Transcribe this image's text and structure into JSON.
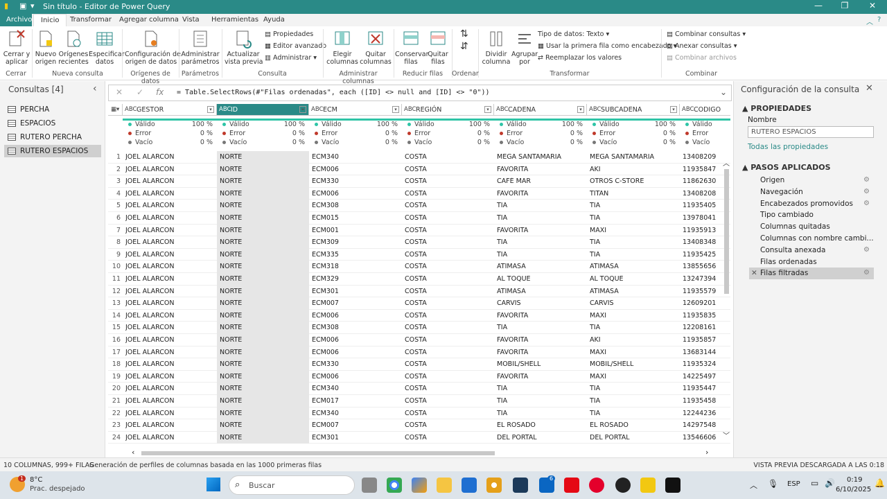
{
  "window": {
    "title": "Sin título - Editor de Power Query"
  },
  "menu": [
    "Archivo",
    "Inicio",
    "Transformar",
    "Agregar columna",
    "Vista",
    "Herramientas",
    "Ayuda"
  ],
  "ribbon": {
    "cerrar_aplicar": "Cerrar y\naplicar",
    "nuevo_origen": "Nuevo\norigen",
    "origenes_recientes": "Orígenes\nrecientes",
    "especificar_datos": "Especificar\ndatos",
    "config_origen": "Configuración de\norigen de datos",
    "admin_param": "Administrar\nparámetros",
    "actualizar": "Actualizar\nvista previa",
    "propiedades": "Propiedades",
    "editor_avanzado": "Editor avanzado",
    "administrar": "Administrar",
    "elegir_columnas": "Elegir\ncolumnas",
    "quitar_columnas": "Quitar\ncolumnas",
    "conservar_filas": "Conservar\nfilas",
    "quitar_filas": "Quitar\nfilas",
    "dividir_columna": "Dividir\ncolumna",
    "agrupar_por": "Agrupar\npor",
    "tipo_datos": "Tipo de datos: Texto",
    "primera_fila": "Usar la primera fila como encabezado",
    "reemplazar": "Reemplazar los valores",
    "combinar_consultas": "Combinar consultas",
    "anexar_consultas": "Anexar consultas",
    "combinar_archivos": "Combinar archivos",
    "groups": {
      "cerrar": "Cerrar",
      "nueva_consulta": "Nueva consulta",
      "origenes": "Orígenes de datos",
      "parametros": "Parámetros",
      "consulta": "Consulta",
      "admin_col": "Administrar columnas",
      "reducir": "Reducir filas",
      "ordenar": "Ordenar",
      "transformar": "Transformar",
      "combinar": "Combinar"
    }
  },
  "queries": {
    "title": "Consultas [4]",
    "items": [
      "PERCHA",
      "ESPACIOS",
      "RUTERO PERCHA",
      "RUTERO ESPACIOS"
    ],
    "selected": 3
  },
  "formula": "= Table.SelectRows(#\"Filas ordenadas\", each ([ID] <> null and [ID] <> \"0\"))",
  "columns": [
    {
      "name": "GESTOR",
      "type": "ABC"
    },
    {
      "name": "ID",
      "type": "ABC"
    },
    {
      "name": "ECM",
      "type": "ABC"
    },
    {
      "name": "REGIÓN",
      "type": "ABC"
    },
    {
      "name": "CADENA",
      "type": "ABC"
    },
    {
      "name": "SUBCADENA",
      "type": "ABC"
    },
    {
      "name": "CODIGO",
      "type": "ABC"
    }
  ],
  "quality": {
    "valid_label": "Válido",
    "error_label": "Error",
    "empty_label": "Vacío",
    "valid": "100 %",
    "error": "0 %",
    "empty": "0 %"
  },
  "rows": [
    [
      "JOEL ALARCON",
      "NORTE",
      "ECM340",
      "COSTA",
      "MEGA SANTAMARIA",
      "MEGA SANTAMARIA",
      "13408209"
    ],
    [
      "JOEL ALARCON",
      "NORTE",
      "ECM006",
      "COSTA",
      "FAVORITA",
      "AKI",
      "11935847"
    ],
    [
      "JOEL ALARCON",
      "NORTE",
      "ECM330",
      "COSTA",
      "CAFÉ MAR",
      "OTROS C-STORE",
      "11862630"
    ],
    [
      "JOEL ALARCON",
      "NORTE",
      "ECM006",
      "COSTA",
      "FAVORITA",
      "TITAN",
      "13408208"
    ],
    [
      "JOEL ALARCON",
      "NORTE",
      "ECM308",
      "COSTA",
      "TIA",
      "TIA",
      "11935405"
    ],
    [
      "JOEL ALARCON",
      "NORTE",
      "ECM015",
      "COSTA",
      "TIA",
      "TIA",
      "13978041"
    ],
    [
      "JOEL ALARCON",
      "NORTE",
      "ECM001",
      "COSTA",
      "FAVORITA",
      "MAXI",
      "11935913"
    ],
    [
      "JOEL ALARCON",
      "NORTE",
      "ECM309",
      "COSTA",
      "TIA",
      "TIA",
      "13408348"
    ],
    [
      "JOEL ALARCON",
      "NORTE",
      "ECM335",
      "COSTA",
      "TIA",
      "TIA",
      "11935425"
    ],
    [
      "JOEL ALARCON",
      "NORTE",
      "ECM318",
      "COSTA",
      "ATIMASA",
      "ATIMASA",
      "13855656"
    ],
    [
      "JOEL ALARCON",
      "NORTE",
      "ECM329",
      "COSTA",
      "AL TOQUE",
      "AL TOQUE",
      "13247394"
    ],
    [
      "JOEL ALARCON",
      "NORTE",
      "ECM301",
      "COSTA",
      "ATIMASA",
      "ATIMASA",
      "11935579"
    ],
    [
      "JOEL ALARCON",
      "NORTE",
      "ECM007",
      "COSTA",
      "CARVIS",
      "CARVIS",
      "12609201"
    ],
    [
      "JOEL ALARCON",
      "NORTE",
      "ECM006",
      "COSTA",
      "FAVORITA",
      "MAXI",
      "11935835"
    ],
    [
      "JOEL ALARCON",
      "NORTE",
      "ECM308",
      "COSTA",
      "TIA",
      "TIA",
      "12208161"
    ],
    [
      "JOEL ALARCON",
      "NORTE",
      "ECM006",
      "COSTA",
      "FAVORITA",
      "AKI",
      "11935857"
    ],
    [
      "JOEL ALARCON",
      "NORTE",
      "ECM006",
      "COSTA",
      "FAVORITA",
      "MAXI",
      "13683144"
    ],
    [
      "JOEL ALARCON",
      "NORTE",
      "ECM330",
      "COSTA",
      "MOBIL/SHELL",
      "MOBIL/SHELL",
      "11935324"
    ],
    [
      "JOEL ALARCON",
      "NORTE",
      "ECM006",
      "COSTA",
      "FAVORITA",
      "MAXI",
      "14225497"
    ],
    [
      "JOEL ALARCON",
      "NORTE",
      "ECM340",
      "COSTA",
      "TIA",
      "TIA",
      "11935447"
    ],
    [
      "JOEL ALARCON",
      "NORTE",
      "ECM017",
      "COSTA",
      "TIA",
      "TIA",
      "11935458"
    ],
    [
      "JOEL ALARCON",
      "NORTE",
      "ECM340",
      "COSTA",
      "TIA",
      "TIA",
      "12244236"
    ],
    [
      "JOEL ALARCON",
      "NORTE",
      "ECM007",
      "COSTA",
      "EL ROSADO",
      "EL ROSADO",
      "14297548"
    ],
    [
      "JOEL ALARCON",
      "NORTE",
      "ECM301",
      "COSTA",
      "DEL PORTAL",
      "DEL PORTAL",
      "13546606"
    ]
  ],
  "config": {
    "title": "Configuración de la consulta",
    "props": "PROPIEDADES",
    "name_label": "Nombre",
    "name_value": "RUTERO ESPACIOS",
    "all_props": "Todas las propiedades",
    "steps_title": "PASOS APLICADOS",
    "steps": [
      "Origen",
      "Navegación",
      "Encabezados promovidos",
      "Tipo cambiado",
      "Columnas quitadas",
      "Columnas con nombre cambi...",
      "Consulta anexada",
      "Filas ordenadas",
      "Filas filtradas"
    ]
  },
  "status": {
    "left": "10 COLUMNAS, 999+ FILAS",
    "profile": "Generación de perfiles de columnas basada en las 1000 primeras filas",
    "right": "VISTA PREVIA DESCARGADA A LAS 0:18"
  },
  "taskbar": {
    "weather_temp": "8°C",
    "weather_desc": "Prac. despejado",
    "search": "Buscar",
    "lang": "ESP",
    "time": "0:19",
    "date": "6/10/2025",
    "badge": "1",
    "badge2": "6"
  }
}
